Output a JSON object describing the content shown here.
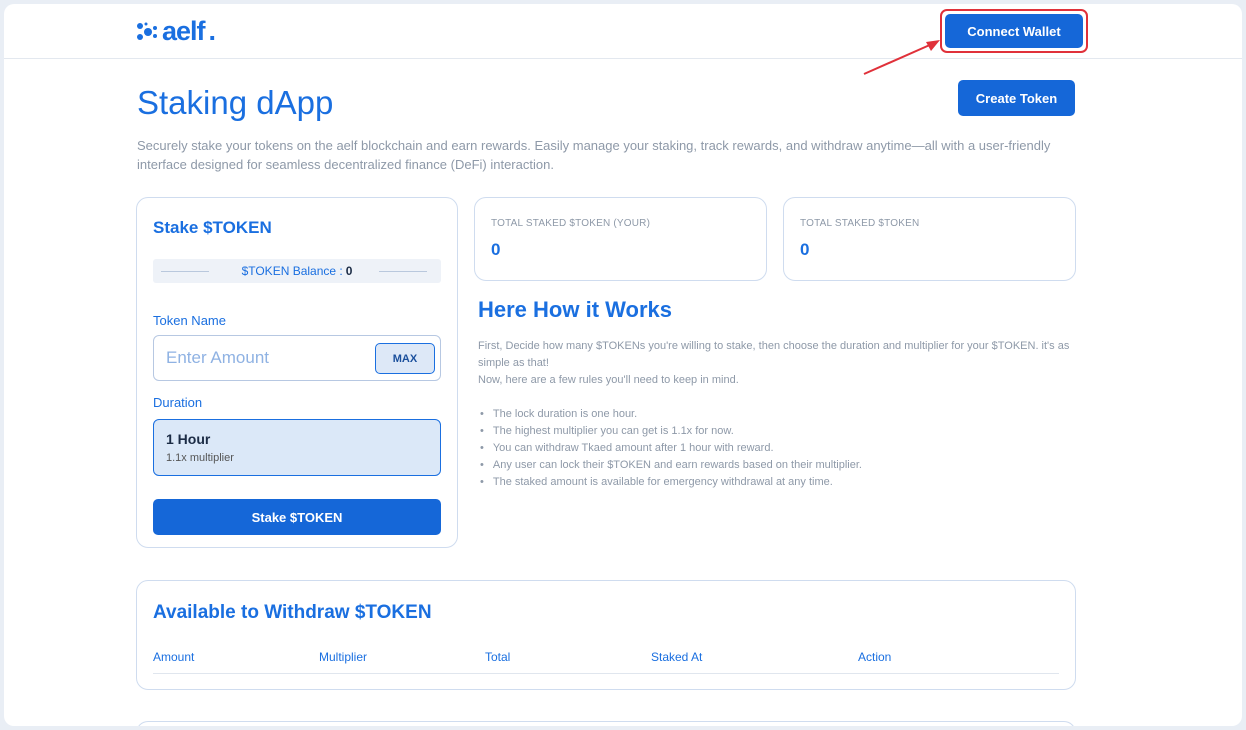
{
  "header": {
    "logo_text": "aelf",
    "connect_label": "Connect Wallet"
  },
  "main": {
    "title": "Staking dApp",
    "description": "Securely stake your tokens on the aelf blockchain and earn rewards. Easily manage your staking, track rewards, and withdraw anytime—all with a user-friendly interface designed for seamless decentralized finance (DeFi) interaction.",
    "create_token_label": "Create Token"
  },
  "stake": {
    "title": "Stake $TOKEN",
    "balance_label": "$TOKEN Balance :",
    "balance_value": "0",
    "token_name_label": "Token Name",
    "amount_placeholder": "Enter Amount",
    "max_label": "MAX",
    "duration_label": "Duration",
    "duration_title": "1 Hour",
    "duration_sub": "1.1x multiplier",
    "stake_button_label": "Stake $TOKEN"
  },
  "stats": [
    {
      "label": "TOTAL STAKED $TOKEN (YOUR)",
      "value": "0"
    },
    {
      "label": "TOTAL STAKED $TOKEN",
      "value": "0"
    }
  ],
  "how": {
    "title": "Here How it Works",
    "intro_1": "First, Decide how many $TOKENs you're willing to stake, then choose the duration and multiplier for your $TOKEN. it's as simple as that!",
    "intro_2": "Now, here are a few rules you'll need to keep in mind.",
    "rules": [
      "The lock duration is one hour.",
      "The highest multiplier you can get is 1.1x for now.",
      "You can withdraw Tkaed amount after 1 hour with reward.",
      "Any user can lock their $TOKEN and earn rewards based on their multiplier.",
      "The staked amount is available for emergency withdrawal at any time."
    ]
  },
  "withdraw": {
    "title": "Available to Withdraw $TOKEN",
    "columns": [
      "Amount",
      "Multiplier",
      "Total",
      "Staked At",
      "Action"
    ]
  },
  "colors": {
    "brand": "#1a6fe0",
    "button": "#1567d8",
    "highlight": "#e0313a"
  }
}
